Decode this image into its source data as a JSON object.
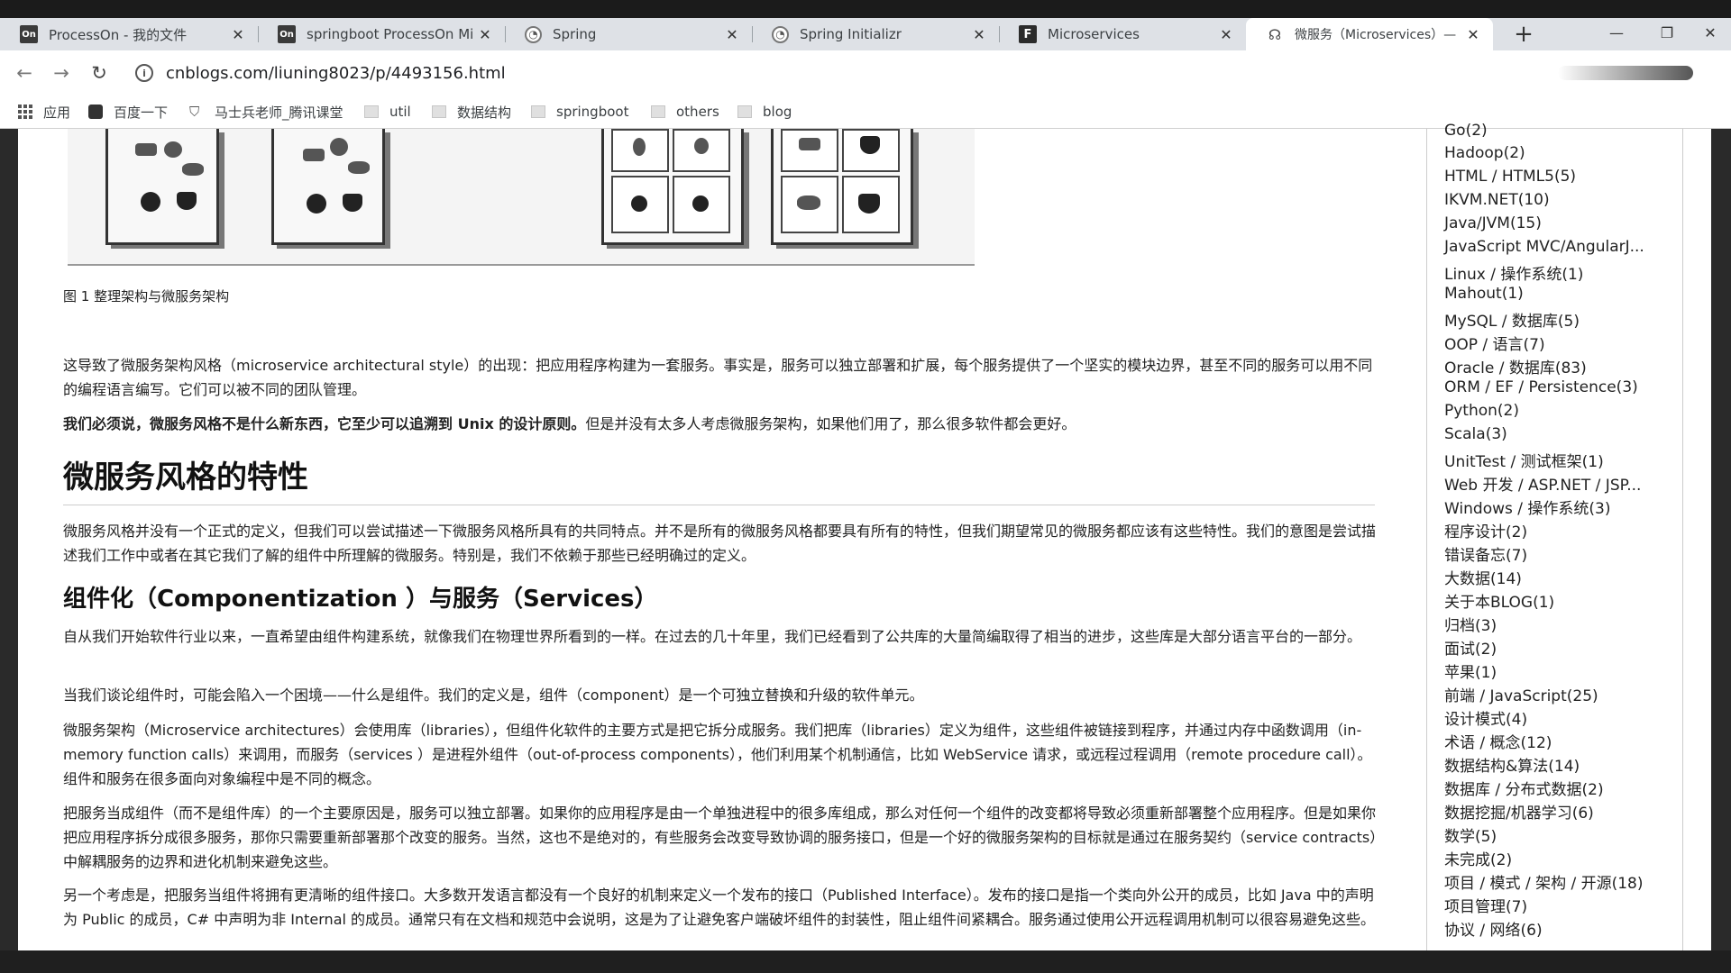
{
  "tabs": [
    {
      "favicon": "On",
      "title": "ProcessOn - 我的文件"
    },
    {
      "favicon": "On",
      "title": "springboot ProcessOn Mi"
    },
    {
      "favicon": "spring",
      "title": "Spring"
    },
    {
      "favicon": "spring",
      "title": "Spring Initializr"
    },
    {
      "favicon": "F",
      "title": "Microservices"
    },
    {
      "favicon": "ms",
      "title": "微服务（Microservices）—"
    }
  ],
  "window": {
    "new_tab": "+",
    "minimize": "—",
    "restore": "❐",
    "close": "✕"
  },
  "address": {
    "url": "cnblogs.com/liuning8023/p/4493156.html"
  },
  "bookmarks": [
    {
      "label": "应用",
      "icon": "apps-grid-icon"
    },
    {
      "label": "百度一下",
      "icon": "paw-icon"
    },
    {
      "label": "马士兵老师_腾讯课堂",
      "icon": "shield-icon"
    },
    {
      "label": "util",
      "icon": "folder-icon"
    },
    {
      "label": "数据结构",
      "icon": "folder-icon"
    },
    {
      "label": "springboot",
      "icon": "folder-icon"
    },
    {
      "label": "others",
      "icon": "folder-icon"
    },
    {
      "label": "blog",
      "icon": "folder-icon"
    }
  ],
  "article": {
    "figure_caption": "图 1 整理架构与微服务架构",
    "p1": "这导致了微服务架构风格（microservice architectural style）的出现：把应用程序构建为一套服务。事实是，服务可以独立部署和扩展，每个服务提供了一个坚实的模块边界，甚至不同的服务可以用不同的编程语言编写。它们可以被不同的团队管理。",
    "p2_bold": "我们必须说，微服务风格不是什么新东西，它至少可以追溯到 Unix 的设计原则。",
    "p2_rest": "但是并没有太多人考虑微服务架构，如果他们用了，那么很多软件都会更好。",
    "h1": "微服务风格的特性",
    "p3": "微服务风格并没有一个正式的定义，但我们可以尝试描述一下微服务风格所具有的共同特点。并不是所有的微服务风格都要具有所有的特性，但我们期望常见的微服务都应该有这些特性。我们的意图是尝试描述我们工作中或者在其它我们了解的组件中所理解的微服务。特别是，我们不依赖于那些已经明确过的定义。",
    "h2": "组件化（Componentization ）与服务（Services）",
    "p4": "自从我们开始软件行业以来，一直希望由组件构建系统，就像我们在物理世界所看到的一样。在过去的几十年里，我们已经看到了公共库的大量简编取得了相当的进步，这些库是大部分语言平台的一部分。",
    "p5": "当我们谈论组件时，可能会陷入一个困境——什么是组件。我们的定义是，组件（component）是一个可独立替换和升级的软件单元。",
    "p6": "微服务架构（Microservice architectures）会使用库（libraries），但组件化软件的主要方式是把它拆分成服务。我们把库（libraries）定义为组件，这些组件被链接到程序，并通过内存中函数调用（in-memory function calls）来调用，而服务（services ）是进程外组件（out-of-process components），他们利用某个机制通信，比如 WebService 请求，或远程过程调用（remote procedure call）。组件和服务在很多面向对象编程中是不同的概念。",
    "p7": "把服务当成组件（而不是组件库）的一个主要原因是，服务可以独立部署。如果你的应用程序是由一个单独进程中的很多库组成，那么对任何一个组件的改变都将导致必须重新部署整个应用程序。但是如果你把应用程序拆分成很多服务，那你只需要重新部署那个改变的服务。当然，这也不是绝对的，有些服务会改变导致协调的服务接口，但是一个好的微服务架构的目标就是通过在服务契约（service contracts）中解耦服务的边界和进化机制来避免这些。",
    "p8": "另一个考虑是，把服务当组件将拥有更清晰的组件接口。大多数开发语言都没有一个良好的机制来定义一个发布的接口（Published Interface）。发布的接口是指一个类向外公开的成员，比如 Java 中的声明为 Public 的成员，C# 中声明为非 Internal 的成员。通常只有在文档和规范中会说明，这是为了让避免客户端破坏组件的封装性，阻止组件间紧耦合。服务通过使用公开远程调用机制可以很容易避免这些。"
  },
  "sidebar": {
    "categories": [
      "Go(2)",
      "Hadoop(2)",
      "HTML / HTML5(5)",
      "IKVM.NET(10)",
      "Java/JVM(15)",
      "JavaScript MVC/AngularJ...",
      "Linux / 操作系统(1)",
      "Mahout(1)",
      "MySQL / 数据库(5)",
      "OOP / 语言(7)",
      "Oracle / 数据库(83)",
      "ORM / EF / Persistence(3)",
      "Python(2)",
      "Scala(3)",
      "UnitTest / 测试框架(1)",
      "Web 开发 / ASP.NET / JSP...",
      "Windows / 操作系统(3)",
      "程序设计(2)",
      "错误备忘(7)",
      "大数据(14)",
      "关于本BLOG(1)",
      "归档(3)",
      "面试(2)",
      "苹果(1)",
      "前端 / JavaScript(25)",
      "设计模式(4)",
      "术语 / 概念(12)",
      "数据结构&算法(14)",
      "数据库 / 分布式数据(2)",
      "数据挖掘/机器学习(6)",
      "数学(5)",
      "未完成(2)",
      "项目 / 模式 / 架构 / 开源(18)",
      "项目管理(7)",
      "协议 / 网络(6)"
    ]
  }
}
